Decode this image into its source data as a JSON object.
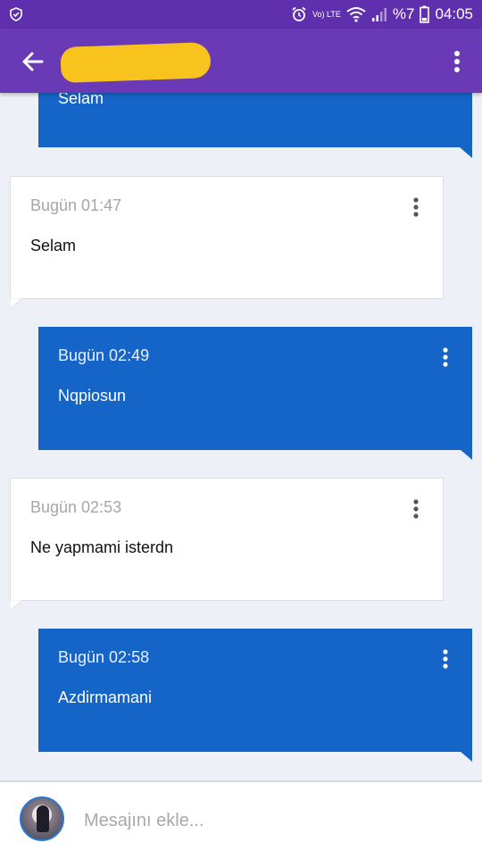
{
  "status_bar": {
    "lte_label": "Vo) LTE",
    "battery": "%7",
    "time": "04:05"
  },
  "app_bar": {
    "back_icon": "arrow-left-icon",
    "menu_icon": "more-vert-icon"
  },
  "messages": [
    {
      "direction": "sent",
      "time": "",
      "text": "Selam"
    },
    {
      "direction": "received",
      "time": "Bugün 01:47",
      "text": "Selam"
    },
    {
      "direction": "sent",
      "time": "Bugün 02:49",
      "text": "Nqpiosun"
    },
    {
      "direction": "received",
      "time": "Bugün 02:53",
      "text": "Ne yapmami isterdn"
    },
    {
      "direction": "sent",
      "time": "Bugün 02:58",
      "text": "Azdirmamani"
    }
  ],
  "composer": {
    "placeholder": "Mesajını ekle..."
  },
  "colors": {
    "status_bar": "#5f2fad",
    "app_bar": "#6a3ab6",
    "sent_bubble": "#1565c8",
    "received_bubble": "#ffffff",
    "background": "#eef0f7"
  }
}
